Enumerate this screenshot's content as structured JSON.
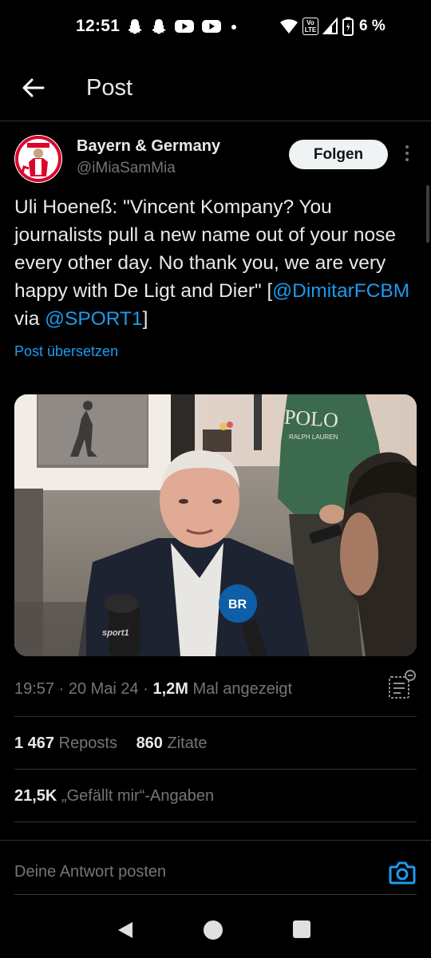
{
  "status_bar": {
    "time": "12:51",
    "lte_label_top": "Vo",
    "lte_label_bottom": "LTE",
    "battery": "6 %",
    "icons": [
      "snapchat-icon",
      "snapchat-icon",
      "youtube-icon",
      "youtube-icon",
      "dot-icon",
      "wifi-icon",
      "signal-icon",
      "battery-icon"
    ]
  },
  "header": {
    "title": "Post"
  },
  "author": {
    "display_name": "Bayern & Germany",
    "handle": "@iMiaSamMia",
    "follow_label": "Folgen"
  },
  "tweet": {
    "text_part1": "Uli Hoeneß: \"Vincent Kompany? You journalists pull a new name out of your nose every other day. No thank you, we are very happy with De Ligt and Dier\" [",
    "mention1": "@DimitarFCBM",
    "text_part2": " via ",
    "mention2": "@SPORT1",
    "text_part3": "]",
    "translate_label": "Post übersetzen"
  },
  "photo": {
    "mic_logo_1": "sport1",
    "mic_logo_2": "BR",
    "shirt_text": "POLO",
    "shirt_subtext": "RALPH LAUREN"
  },
  "meta": {
    "time": "19:57",
    "separator": " · ",
    "date": "20 Mai 24",
    "views": "1,2M",
    "views_label": " Mal angezeigt"
  },
  "stats": {
    "reposts_count": "1 467",
    "reposts_label": " Reposts",
    "quotes_count": "860",
    "quotes_label": " Zitate",
    "likes_count": "21,5K",
    "likes_label": " „Gefällt mir“-Angaben"
  },
  "reply": {
    "placeholder": "Deine Antwort posten"
  },
  "colors": {
    "background": "#000000",
    "text_primary": "#e7e9ea",
    "text_secondary": "#71767b",
    "accent": "#1d9bf0",
    "divider": "#2f3336"
  }
}
